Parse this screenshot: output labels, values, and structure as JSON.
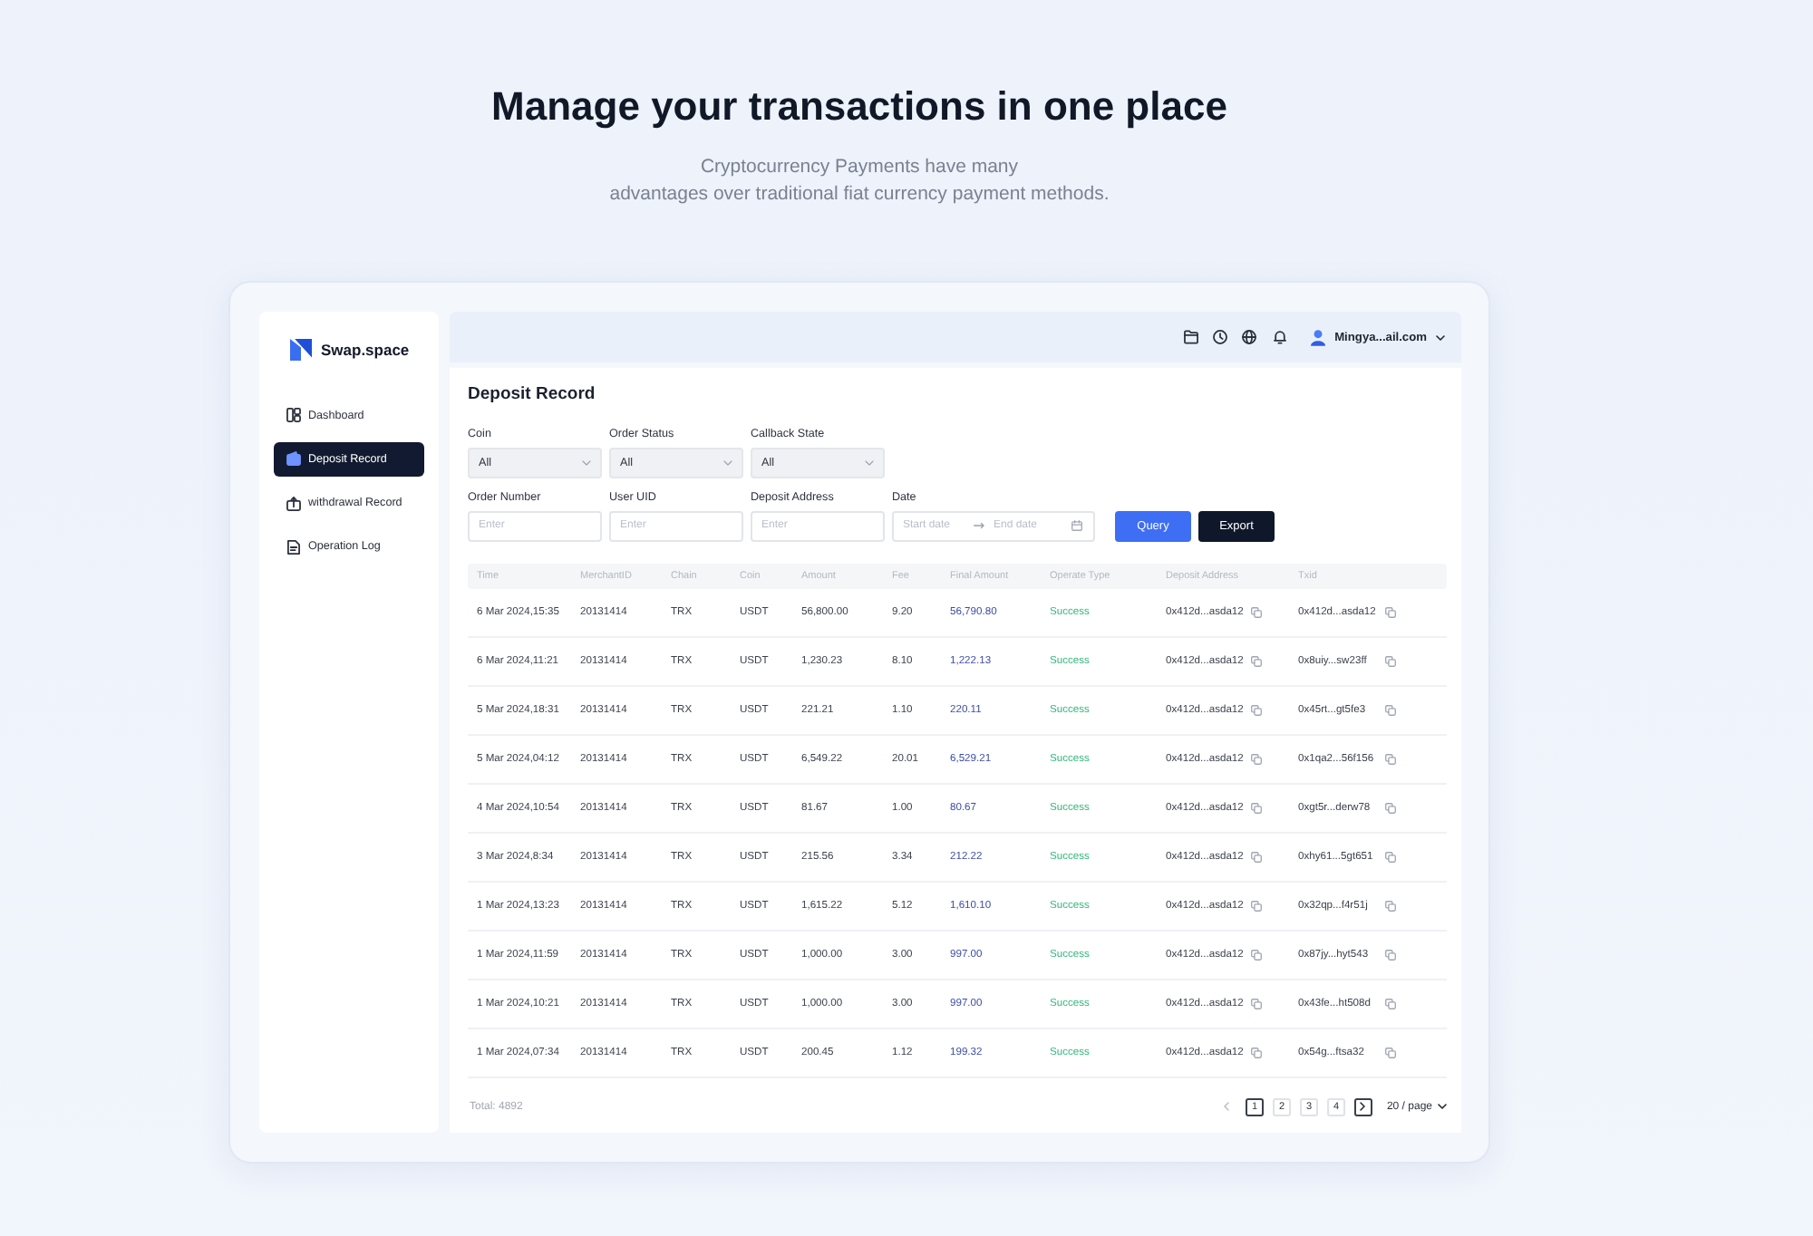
{
  "hero": {
    "title": "Manage your transactions in one place",
    "subtitle_lines": [
      "Cryptocurrency Payments have many",
      "advantages over traditional fiat currency payment methods."
    ]
  },
  "sidebar": {
    "logo": "Swap.space",
    "items": [
      {
        "label": "Dashboard",
        "selected": false
      },
      {
        "label": "Deposit Record",
        "selected": true
      },
      {
        "label": "withdrawal Record",
        "selected": false
      },
      {
        "label": "Operation Log",
        "selected": false
      }
    ]
  },
  "topbar": {
    "user": "Mingya...ail.com"
  },
  "panel": {
    "title": "Deposit Record",
    "filter_rows": [
      {
        "fields": [
          {
            "kind": "select",
            "label": "Coin",
            "value": "All"
          },
          {
            "kind": "select",
            "label": "Order Status",
            "value": "All"
          },
          {
            "kind": "select",
            "label": "Callback State",
            "value": "All"
          }
        ]
      },
      {
        "fields": [
          {
            "kind": "input",
            "label": "Order Number",
            "placeholder": "Enter"
          },
          {
            "kind": "input",
            "label": "User UID",
            "placeholder": "Enter"
          },
          {
            "kind": "input",
            "label": "Deposit Address",
            "placeholder": "Enter"
          },
          {
            "kind": "daterange",
            "label": "Date",
            "start_placeholder": "Start date",
            "end_placeholder": "End date"
          }
        ],
        "buttons": [
          {
            "kind": "primary",
            "label": "Query"
          },
          {
            "kind": "dark",
            "label": "Export"
          }
        ]
      }
    ]
  },
  "table": {
    "columns": [
      "Time",
      "MerchantID",
      "Chain",
      "Coin",
      "Amount",
      "Fee",
      "Final Amount",
      "Operate Type",
      "Deposit Address",
      "Txid"
    ],
    "rows": [
      {
        "time": "6 Mar 2024,15:35",
        "merchant_id": "20131414",
        "chain": "TRX",
        "coin": "USDT",
        "amount": "56,800.00",
        "fee": "9.20",
        "final_amount": "56,790.80",
        "operate_type": "Success",
        "deposit_address": "0x412d...asda12",
        "txid": "0x412d...asda12"
      },
      {
        "time": "6 Mar 2024,11:21",
        "merchant_id": "20131414",
        "chain": "TRX",
        "coin": "USDT",
        "amount": "1,230.23",
        "fee": "8.10",
        "final_amount": "1,222.13",
        "operate_type": "Success",
        "deposit_address": "0x412d...asda12",
        "txid": "0x8uiy...sw23ff"
      },
      {
        "time": "5 Mar 2024,18:31",
        "merchant_id": "20131414",
        "chain": "TRX",
        "coin": "USDT",
        "amount": "221.21",
        "fee": "1.10",
        "final_amount": "220.11",
        "operate_type": "Success",
        "deposit_address": "0x412d...asda12",
        "txid": "0x45rt...gt5fe3"
      },
      {
        "time": "5 Mar 2024,04:12",
        "merchant_id": "20131414",
        "chain": "TRX",
        "coin": "USDT",
        "amount": "6,549.22",
        "fee": "20.01",
        "final_amount": "6,529.21",
        "operate_type": "Success",
        "deposit_address": "0x412d...asda12",
        "txid": "0x1qa2...56f156"
      },
      {
        "time": "4 Mar 2024,10:54",
        "merchant_id": "20131414",
        "chain": "TRX",
        "coin": "USDT",
        "amount": "81.67",
        "fee": "1.00",
        "final_amount": "80.67",
        "operate_type": "Success",
        "deposit_address": "0x412d...asda12",
        "txid": "0xgt5r...derw78"
      },
      {
        "time": "3 Mar 2024,8:34",
        "merchant_id": "20131414",
        "chain": "TRX",
        "coin": "USDT",
        "amount": "215.56",
        "fee": "3.34",
        "final_amount": "212.22",
        "operate_type": "Success",
        "deposit_address": "0x412d...asda12",
        "txid": "0xhy61...5gt651"
      },
      {
        "time": "1 Mar 2024,13:23",
        "merchant_id": "20131414",
        "chain": "TRX",
        "coin": "USDT",
        "amount": "1,615.22",
        "fee": "5.12",
        "final_amount": "1,610.10",
        "operate_type": "Success",
        "deposit_address": "0x412d...asda12",
        "txid": "0x32qp...f4r51j"
      },
      {
        "time": "1 Mar 2024,11:59",
        "merchant_id": "20131414",
        "chain": "TRX",
        "coin": "USDT",
        "amount": "1,000.00",
        "fee": "3.00",
        "final_amount": "997.00",
        "operate_type": "Success",
        "deposit_address": "0x412d...asda12",
        "txid": "0x87jy...hyt543"
      },
      {
        "time": "1 Mar 2024,10:21",
        "merchant_id": "20131414",
        "chain": "TRX",
        "coin": "USDT",
        "amount": "1,000.00",
        "fee": "3.00",
        "final_amount": "997.00",
        "operate_type": "Success",
        "deposit_address": "0x412d...asda12",
        "txid": "0x43fe...ht508d"
      },
      {
        "time": "1 Mar 2024,07:34",
        "merchant_id": "20131414",
        "chain": "TRX",
        "coin": "USDT",
        "amount": "200.45",
        "fee": "1.12",
        "final_amount": "199.32",
        "operate_type": "Success",
        "deposit_address": "0x412d...asda12",
        "txid": "0x54g...ftsa32"
      }
    ]
  },
  "footer": {
    "total": "Total: 4892",
    "pagination": {
      "prev": {
        "disabled": true
      },
      "pages": [
        {
          "label": "1",
          "selected": true
        },
        {
          "label": "2",
          "selected": false
        },
        {
          "label": "3",
          "selected": false
        },
        {
          "label": "4",
          "selected": false
        }
      ],
      "next": {
        "disabled": false
      },
      "page_size": "20 / page"
    }
  }
}
